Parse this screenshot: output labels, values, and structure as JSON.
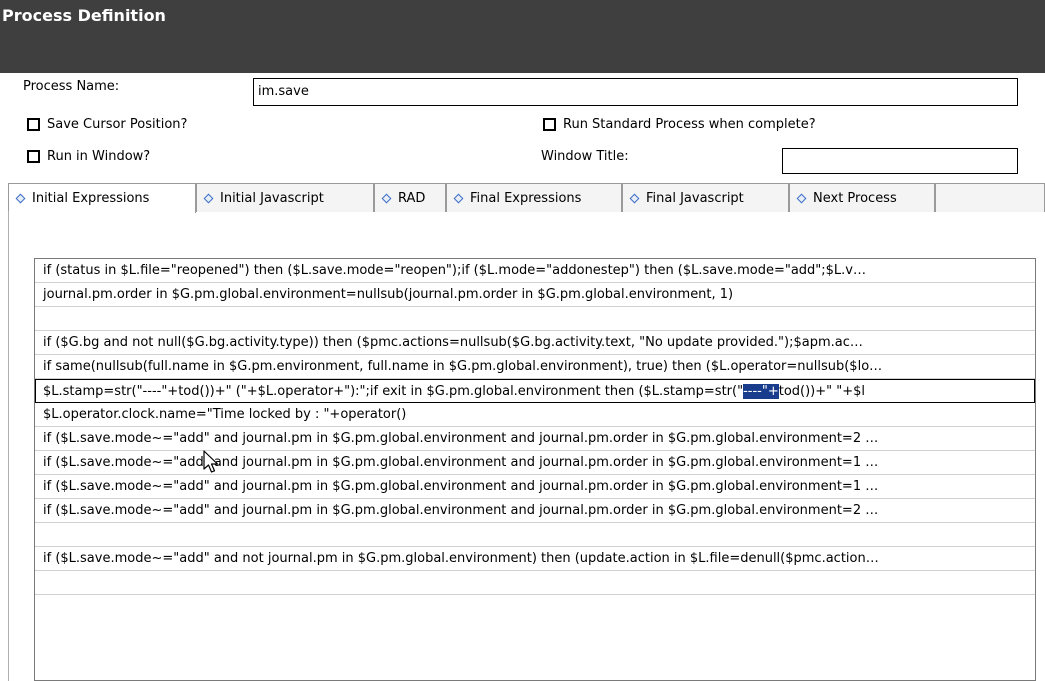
{
  "header": {
    "title": "Process Definition"
  },
  "form": {
    "process_name_label": "Process Name:",
    "process_name_value": "im.save",
    "save_cursor_label": "Save Cursor Position?",
    "run_standard_label": "Run Standard Process when complete?",
    "run_in_window_label": "Run in Window?",
    "window_title_label": "Window Title:",
    "window_title_value": ""
  },
  "tabs": [
    {
      "label": "Initial Expressions",
      "active": true
    },
    {
      "label": "Initial Javascript"
    },
    {
      "label": "RAD"
    },
    {
      "label": "Final Expressions"
    },
    {
      "label": "Final Javascript"
    },
    {
      "label": "Next Process"
    }
  ],
  "expressions": [
    "if (status in $L.file=\"reopened\") then ($L.save.mode=\"reopen\");if ($L.mode=\"addonestep\") then ($L.save.mode=\"add\";$L.v…",
    "journal.pm.order in $G.pm.global.environment=nullsub(journal.pm.order in $G.pm.global.environment, 1)",
    "",
    "if ($G.bg and not null($G.bg.activity.type)) then ($pmc.actions=nullsub($G.bg.activity.text, \"No update provided.\");$apm.ac…",
    "if same(nullsub(full.name in $G.pm.environment, full.name in $G.pm.global.environment), true) then ($L.operator=nullsub($lo…",
    "",
    "$L.operator.clock.name=\"Time locked by : \"+operator()",
    "if ($L.save.mode~=\"add\" and journal.pm in $G.pm.global.environment and journal.pm.order in $G.pm.global.environment=2 …",
    "if ($L.save.mode~=\"add\" and journal.pm in $G.pm.global.environment and journal.pm.order in $G.pm.global.environment=1 …",
    "if ($L.save.mode~=\"add\" and journal.pm in $G.pm.global.environment and journal.pm.order in $G.pm.global.environment=1 …",
    "if ($L.save.mode~=\"add\" and journal.pm in $G.pm.global.environment and journal.pm.order in $G.pm.global.environment=2 …",
    "",
    "if ($L.save.mode~=\"add\" and not journal.pm in $G.pm.global.environment) then (update.action in $L.file=denull($pmc.action…",
    ""
  ],
  "editing_row": {
    "before": "$L.stamp=str(\"----\"+tod())+\" (\"+$L.operator+\"):\";if exit in $G.pm.global.environment then ($L.stamp=str(\"",
    "selected": "----\"+",
    "after": "tod())+\" \"+$l"
  }
}
